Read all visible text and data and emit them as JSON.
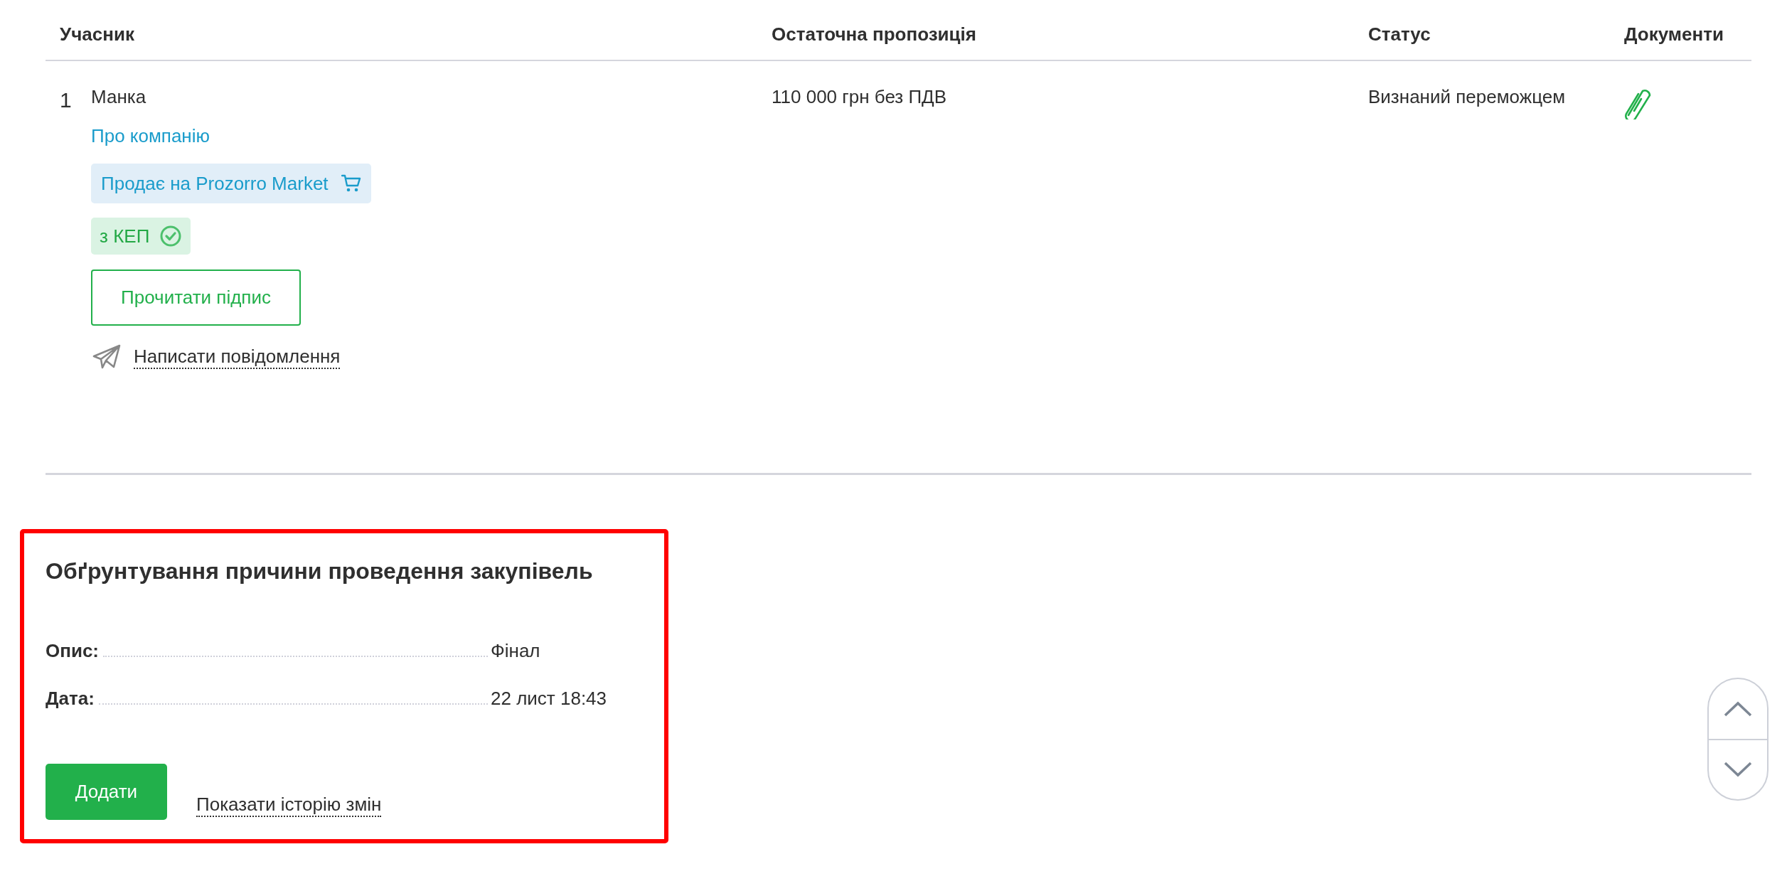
{
  "table": {
    "columns": [
      "Учасник",
      "Остаточна пропозиція",
      "Статус",
      "Документи"
    ],
    "rows": [
      {
        "number": "1",
        "name": "Манка",
        "about_link": "Про компанію",
        "market_badge": "Продає на Prozorro Market",
        "signature_badge": "з КЕП",
        "read_signature_button": "Прочитати підпис",
        "message_link": "Написати повідомлення",
        "final_offer": "110 000 грн без ПДВ",
        "status": "Визнаний переможцем"
      }
    ]
  },
  "justification": {
    "title": "Обґрунтування причини проведення закупівель",
    "highlighted": true,
    "fields": [
      {
        "label": "Опис:",
        "value": "Фінал"
      },
      {
        "label": "Дата:",
        "value": "22 лист 18:43"
      }
    ],
    "add_button": "Додати",
    "history_link": "Показати історію змін"
  }
}
